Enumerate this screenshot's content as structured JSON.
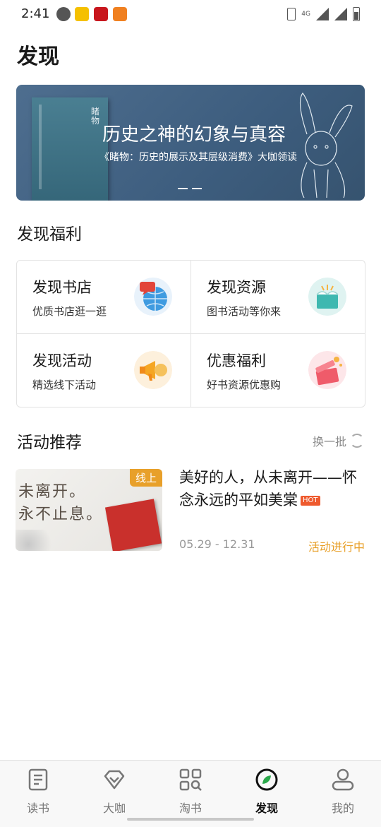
{
  "status_bar": {
    "time": "2:41",
    "network": "4G",
    "icons": [
      "message-icon",
      "weibo-icon",
      "netease-icon",
      "uc-browser-icon"
    ]
  },
  "page": {
    "title": "发现"
  },
  "banner": {
    "headline": "历史之神的幻象与真容",
    "subtitle": "《睹物：历史的展示及其层级消费》大咖领读",
    "book_title": "睹物",
    "active_dot": 1,
    "dots": 2
  },
  "welfare": {
    "section_title": "发现福利",
    "items": [
      {
        "title": "发现书店",
        "subtitle": "优质书店逛一逛",
        "icon": "globe-chat-icon",
        "color": "#4aa3e8"
      },
      {
        "title": "发现资源",
        "subtitle": "图书活动等你来",
        "icon": "open-book-icon",
        "color": "#3fb8b0"
      },
      {
        "title": "发现活动",
        "subtitle": "精选线下活动",
        "icon": "megaphone-icon",
        "color": "#f5a623"
      },
      {
        "title": "优惠福利",
        "subtitle": "好书资源优惠购",
        "icon": "gift-box-icon",
        "color": "#ef5b6a"
      }
    ]
  },
  "activities": {
    "section_title": "活动推荐",
    "refresh_label": "换一批",
    "items": [
      {
        "badge": "线上",
        "thumb_line1": "未离开。",
        "thumb_line2": "永不止息。",
        "title": "美好的人，从未离开——怀念永远的平如美棠",
        "hot": "HOT",
        "date": "05.29 - 12.31",
        "status": "活动进行中"
      }
    ]
  },
  "tabbar": {
    "active": "发现",
    "tabs": [
      {
        "label": "读书",
        "icon": "book-icon"
      },
      {
        "label": "大咖",
        "icon": "diamond-icon"
      },
      {
        "label": "淘书",
        "icon": "grid-search-icon"
      },
      {
        "label": "发现",
        "icon": "compass-icon"
      },
      {
        "label": "我的",
        "icon": "person-icon"
      }
    ]
  },
  "colors": {
    "accent": "#e8a02a",
    "hot": "#ee5a2e"
  }
}
